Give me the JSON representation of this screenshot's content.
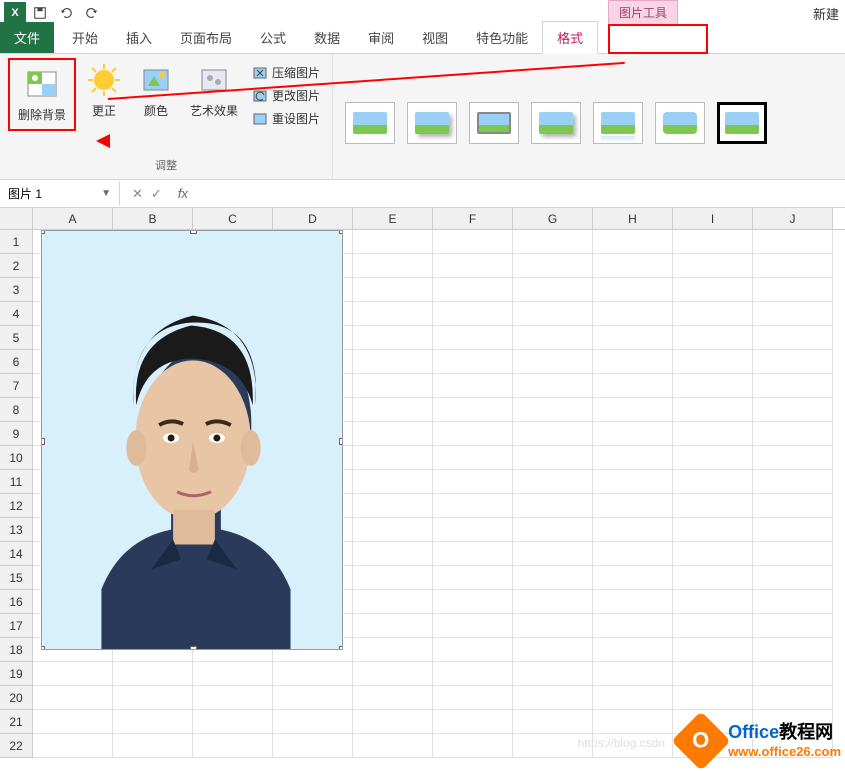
{
  "qat": {
    "app": "X"
  },
  "title": {
    "context_label": "图片工具",
    "right": "新建"
  },
  "tabs": {
    "file": "文件",
    "home": "开始",
    "insert": "插入",
    "layout": "页面布局",
    "formulas": "公式",
    "data": "数据",
    "review": "审阅",
    "view": "视图",
    "special": "特色功能",
    "format": "格式"
  },
  "ribbon": {
    "remove_bg": "删除背景",
    "corrections": "更正",
    "color": "颜色",
    "artistic": "艺术效果",
    "compress": "压缩图片",
    "change": "更改图片",
    "reset": "重设图片",
    "group_adjust": "调整"
  },
  "formula_bar": {
    "name_box": "图片 1",
    "cancel": "✕",
    "confirm": "✓",
    "fx": "fx"
  },
  "columns": [
    "A",
    "B",
    "C",
    "D",
    "E",
    "F",
    "G",
    "H",
    "I",
    "J"
  ],
  "rows": [
    "1",
    "2",
    "3",
    "4",
    "5",
    "6",
    "7",
    "8",
    "9",
    "10",
    "11",
    "12",
    "13",
    "14",
    "15",
    "16",
    "17",
    "18",
    "19",
    "20",
    "21",
    "22"
  ],
  "watermark_url": "https://blog.csdn",
  "brand": {
    "icon_letter": "O",
    "line1_blue": "Office",
    "line1_black": "教程网",
    "line2": "www.office26.com"
  }
}
